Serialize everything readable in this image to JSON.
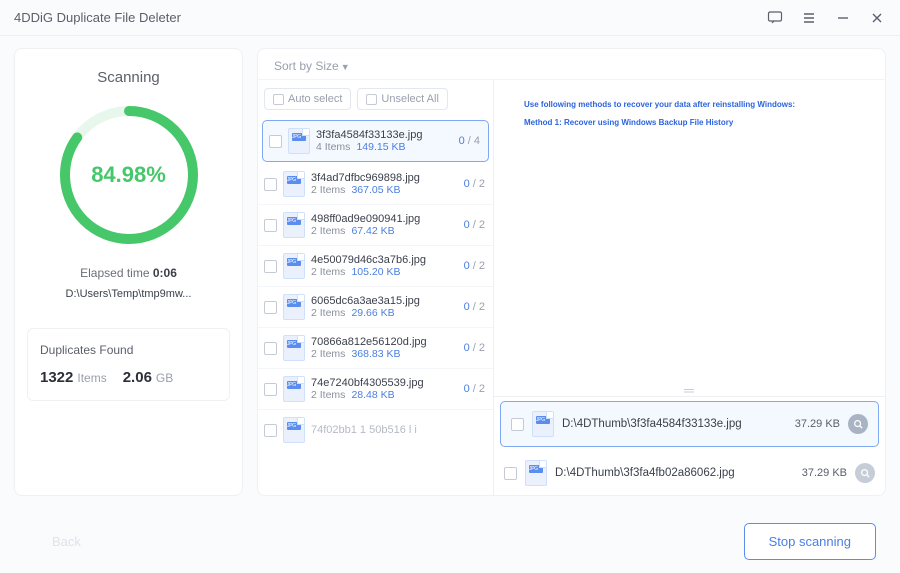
{
  "title": "4DDiG Duplicate File Deleter",
  "scan": {
    "label": "Scanning",
    "percent": 84.98,
    "percent_text": "84.98%",
    "elapsed_label": "Elapsed time",
    "elapsed_value": "0:06",
    "path": "D:\\Users\\Temp\\tmp9mw..."
  },
  "duplicates": {
    "title": "Duplicates Found",
    "count": "1322",
    "count_unit": "Items",
    "size": "2.06",
    "size_unit": "GB"
  },
  "sort": {
    "label": "Sort by Size"
  },
  "chips": {
    "auto": "Auto select",
    "unselect": "Unselect All"
  },
  "groups": [
    {
      "name": "3f3fa4584f33133e.jpg",
      "items": "4 Items",
      "size": "149.15 KB",
      "sel": "0",
      "total": "4",
      "selected": true
    },
    {
      "name": "3f4ad7dfbc969898.jpg",
      "items": "2 Items",
      "size": "367.05 KB",
      "sel": "0",
      "total": "2"
    },
    {
      "name": "498ff0ad9e090941.jpg",
      "items": "2 Items",
      "size": "67.42 KB",
      "sel": "0",
      "total": "2"
    },
    {
      "name": "4e50079d46c3a7b6.jpg",
      "items": "2 Items",
      "size": "105.20 KB",
      "sel": "0",
      "total": "2"
    },
    {
      "name": "6065dc6a3ae3a15.jpg",
      "items": "2 Items",
      "size": "29.66 KB",
      "sel": "0",
      "total": "2"
    },
    {
      "name": "70866a812e56120d.jpg",
      "items": "2 Items",
      "size": "368.83 KB",
      "sel": "0",
      "total": "2"
    },
    {
      "name": "74e7240bf4305539.jpg",
      "items": "2 Items",
      "size": "28.48 KB",
      "sel": "0",
      "total": "2"
    }
  ],
  "group_tail": "74f02bb1 1 50b516 l i",
  "preview": {
    "line1": "Use following methods to recover your data after reinstalling Windows:",
    "line2": "Method 1: Recover using Windows Backup File History"
  },
  "details": [
    {
      "name": "D:\\4DThumb\\3f3fa4584f33133e.jpg",
      "size": "37.29 KB",
      "hl": true
    },
    {
      "name": "D:\\4DThumb\\3f3fa4fb02a86062.jpg",
      "size": "37.29 KB",
      "hl": false
    }
  ],
  "footer": {
    "back": "Back",
    "stop": "Stop scanning"
  }
}
